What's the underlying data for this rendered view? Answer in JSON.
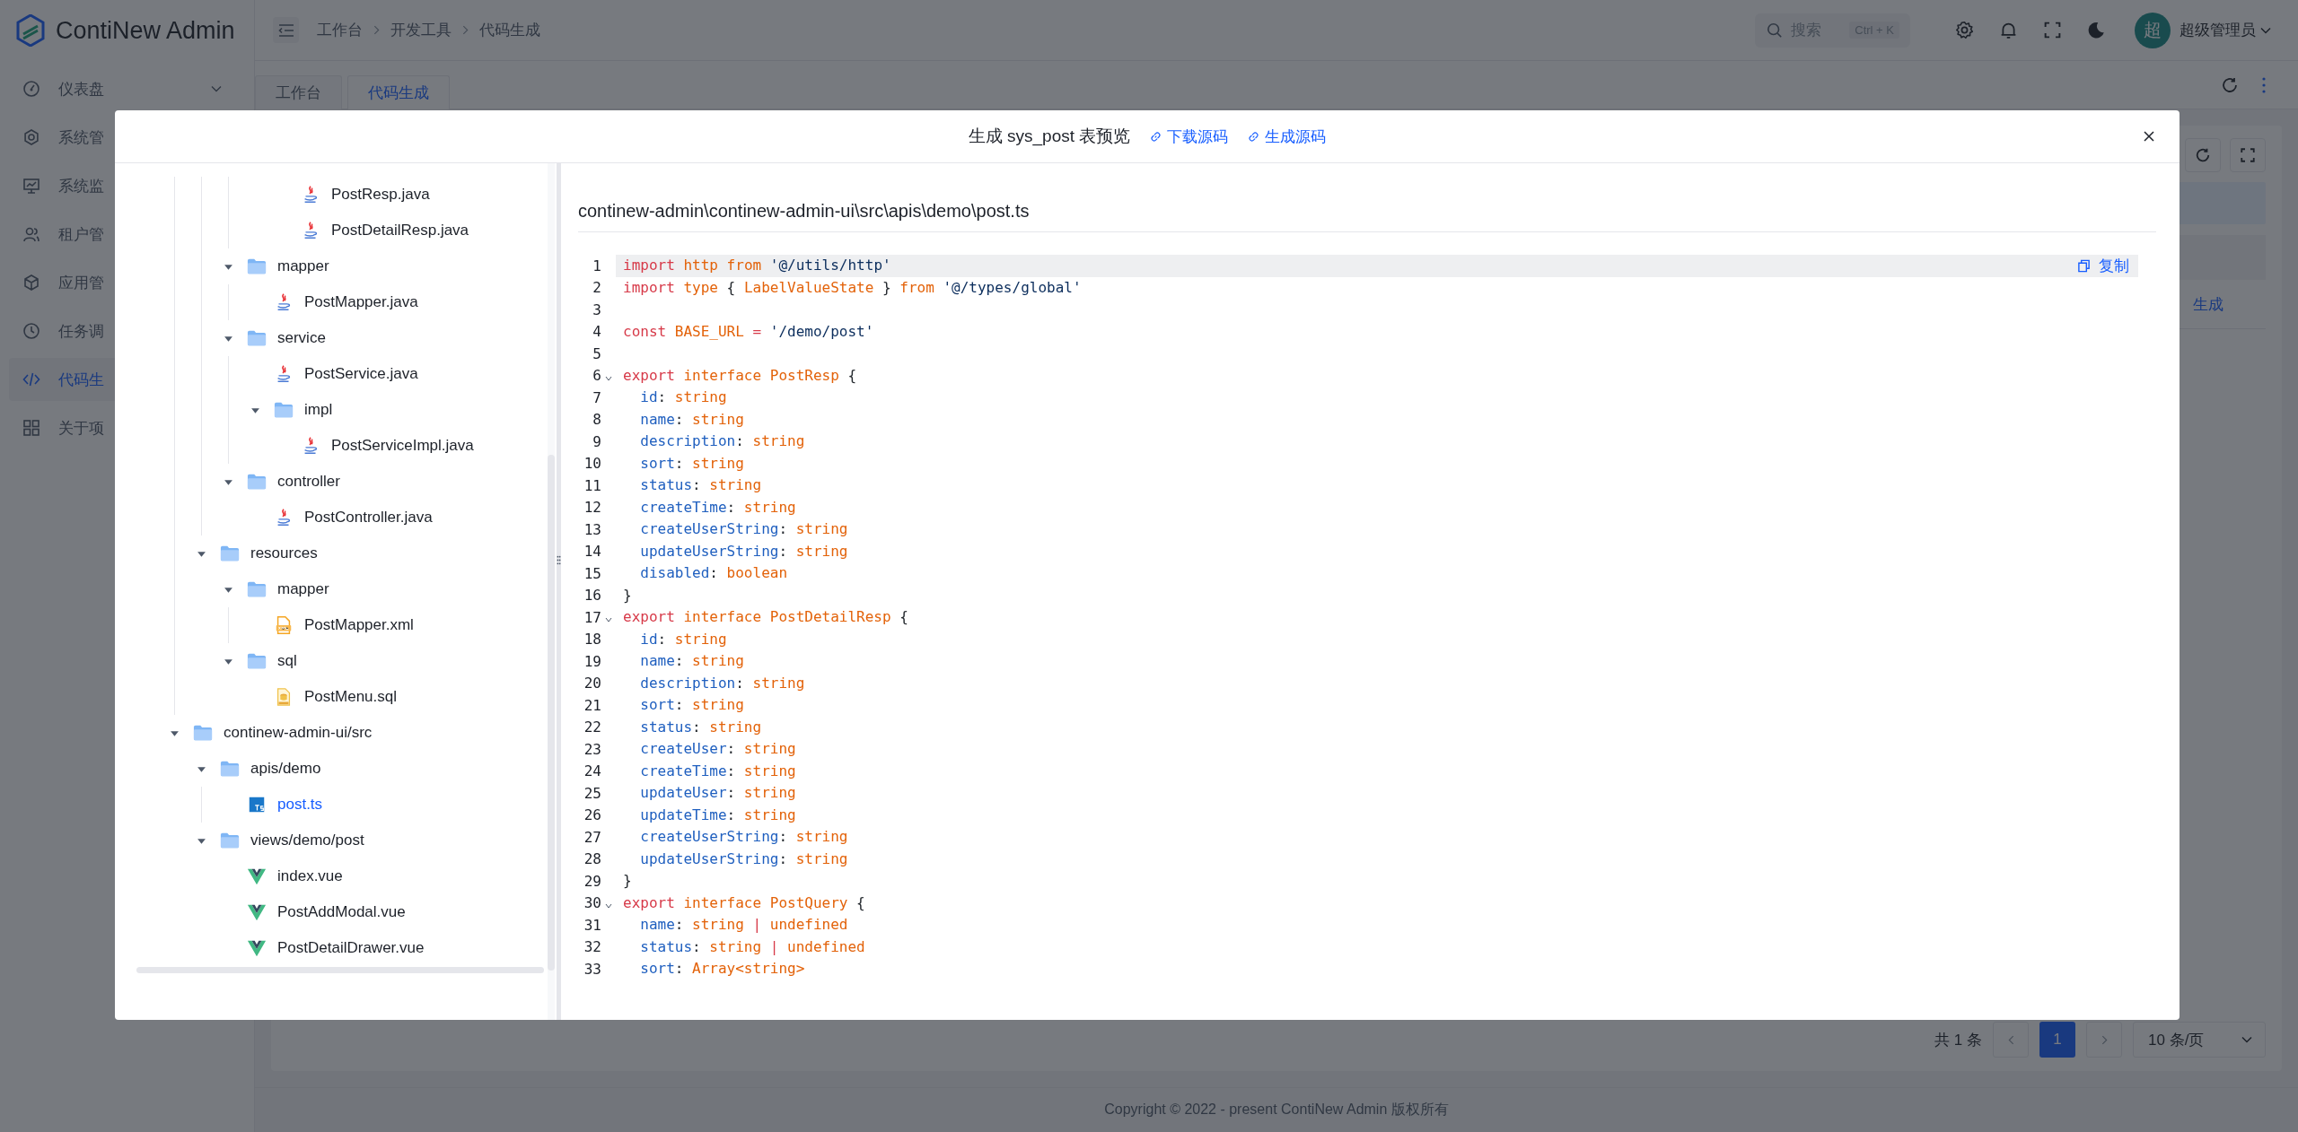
{
  "app": {
    "logo_text": "ContiNew Admin"
  },
  "header": {
    "breadcrumbs": [
      "工作台",
      "开发工具",
      "代码生成"
    ],
    "search": {
      "placeholder": "搜索",
      "shortcut": "Ctrl + K"
    },
    "avatar_text": "超",
    "user_name": "超级管理员"
  },
  "sidebar": {
    "items": [
      {
        "label": "仪表盘",
        "selected": false,
        "expandable": true
      },
      {
        "label": "系统管",
        "selected": false
      },
      {
        "label": "系统监",
        "selected": false
      },
      {
        "label": "租户管",
        "selected": false
      },
      {
        "label": "应用管",
        "selected": false
      },
      {
        "label": "任务调",
        "selected": false
      },
      {
        "label": "代码生",
        "selected": true
      },
      {
        "label": "关于项",
        "selected": false
      }
    ]
  },
  "tabs": [
    {
      "label": "工作台",
      "selected": false
    },
    {
      "label": "代码生成",
      "selected": true
    }
  ],
  "table": {
    "rows": [
      {
        "action_link": "生成"
      }
    ]
  },
  "pagination": {
    "total": "共 1 条",
    "pages": [
      {
        "label": "1",
        "selected": true
      }
    ],
    "page_size": "10 条/页"
  },
  "footer": {
    "copyright": "Copyright © 2022 - present ContiNew Admin 版权所有"
  },
  "modal": {
    "title": "生成 sys_post 表预览",
    "links": [
      "下载源码",
      "生成源码"
    ],
    "tree": [
      {
        "children": [
          {
            "children": [
              {
                "children": [
                  {
                    "children": [
                      {
                        "label": "PostResp.java",
                        "kind": "java",
                        "selected": false
                      },
                      {
                        "label": "PostDetailResp.java",
                        "kind": "java",
                        "selected": false
                      }
                    ]
                  }
                ]
              },
              {
                "label": "mapper",
                "kind": "folder",
                "expanded": true,
                "children": [
                  {
                    "label": "PostMapper.java",
                    "kind": "java",
                    "selected": false
                  }
                ]
              },
              {
                "label": "service",
                "kind": "folder",
                "expanded": true,
                "children": [
                  {
                    "label": "PostService.java",
                    "kind": "java",
                    "selected": false
                  },
                  {
                    "label": "impl",
                    "kind": "folder",
                    "expanded": true,
                    "children": [
                      {
                        "label": "PostServiceImpl.java",
                        "kind": "java",
                        "selected": false
                      }
                    ]
                  }
                ]
              },
              {
                "label": "controller",
                "kind": "folder",
                "expanded": true,
                "children": [
                  {
                    "label": "PostController.java",
                    "kind": "java",
                    "selected": false
                  }
                ]
              }
            ]
          },
          {
            "label": "resources",
            "kind": "folder",
            "expanded": true,
            "children": [
              {
                "label": "mapper",
                "kind": "folder",
                "expanded": true,
                "children": [
                  {
                    "label": "PostMapper.xml",
                    "kind": "xml",
                    "selected": false
                  }
                ]
              },
              {
                "label": "sql",
                "kind": "folder",
                "expanded": true,
                "children": [
                  {
                    "label": "PostMenu.sql",
                    "kind": "sql",
                    "selected": false
                  }
                ]
              }
            ]
          }
        ]
      },
      {
        "label": "continew-admin-ui/src",
        "kind": "folder",
        "expanded": true,
        "children": [
          {
            "label": "apis/demo",
            "kind": "folder",
            "expanded": true,
            "children": [
              {
                "label": "post.ts",
                "kind": "ts",
                "selected": true
              }
            ]
          },
          {
            "label": "views/demo/post",
            "kind": "folder",
            "expanded": true,
            "children": [
              {
                "label": "index.vue",
                "kind": "vue",
                "selected": false
              },
              {
                "label": "PostAddModal.vue",
                "kind": "vue",
                "selected": false
              },
              {
                "label": "PostDetailDrawer.vue",
                "kind": "vue",
                "selected": false
              }
            ]
          }
        ]
      }
    ],
    "code": {
      "path": "continew-admin\\continew-admin-ui\\src\\apis\\demo\\post.ts",
      "copy_label": "复制",
      "lines": [
        {
          "number": "1",
          "active": true,
          "foldable": false,
          "tokens": [
            {
              "kind": "keyword",
              "text": "import "
            },
            {
              "kind": "type",
              "text": "http "
            },
            {
              "kind": "type",
              "text": "from "
            },
            {
              "kind": "string",
              "text": "'@/utils/http'"
            }
          ]
        },
        {
          "number": "2",
          "active": false,
          "foldable": false,
          "tokens": [
            {
              "kind": "keyword",
              "text": "import "
            },
            {
              "kind": "type",
              "text": "type "
            },
            {
              "kind": "punct",
              "text": "{ "
            },
            {
              "kind": "type",
              "text": "LabelValueState "
            },
            {
              "kind": "punct",
              "text": "} "
            },
            {
              "kind": "type",
              "text": "from "
            },
            {
              "kind": "string",
              "text": "'@/types/global'"
            }
          ]
        },
        {
          "number": "3",
          "active": false,
          "foldable": false
        },
        {
          "number": "4",
          "active": false,
          "foldable": false,
          "tokens": [
            {
              "kind": "keyword",
              "text": "const "
            },
            {
              "kind": "type",
              "text": "BASE_URL "
            },
            {
              "kind": "operator",
              "text": "= "
            },
            {
              "kind": "string",
              "text": "'/demo/post'"
            }
          ]
        },
        {
          "number": "5",
          "active": false,
          "foldable": false
        },
        {
          "number": "6",
          "active": false,
          "foldable": true,
          "tokens": [
            {
              "kind": "keyword",
              "text": "export "
            },
            {
              "kind": "type",
              "text": "interface "
            },
            {
              "kind": "type",
              "text": "PostResp "
            },
            {
              "kind": "punct",
              "text": "{"
            }
          ]
        },
        {
          "number": "7",
          "active": false,
          "foldable": false,
          "tokens": [
            {
              "kind": "property",
              "text": "  id"
            },
            {
              "kind": "punct",
              "text": ": "
            },
            {
              "kind": "type",
              "text": "string"
            }
          ]
        },
        {
          "number": "8",
          "active": false,
          "foldable": false,
          "tokens": [
            {
              "kind": "property",
              "text": "  name"
            },
            {
              "kind": "punct",
              "text": ": "
            },
            {
              "kind": "type",
              "text": "string"
            }
          ]
        },
        {
          "number": "9",
          "active": false,
          "foldable": false,
          "tokens": [
            {
              "kind": "property",
              "text": "  description"
            },
            {
              "kind": "punct",
              "text": ": "
            },
            {
              "kind": "type",
              "text": "string"
            }
          ]
        },
        {
          "number": "10",
          "active": false,
          "foldable": false,
          "tokens": [
            {
              "kind": "property",
              "text": "  sort"
            },
            {
              "kind": "punct",
              "text": ": "
            },
            {
              "kind": "type",
              "text": "string"
            }
          ]
        },
        {
          "number": "11",
          "active": false,
          "foldable": false,
          "tokens": [
            {
              "kind": "property",
              "text": "  status"
            },
            {
              "kind": "punct",
              "text": ": "
            },
            {
              "kind": "type",
              "text": "string"
            }
          ]
        },
        {
          "number": "12",
          "active": false,
          "foldable": false,
          "tokens": [
            {
              "kind": "property",
              "text": "  createTime"
            },
            {
              "kind": "punct",
              "text": ": "
            },
            {
              "kind": "type",
              "text": "string"
            }
          ]
        },
        {
          "number": "13",
          "active": false,
          "foldable": false,
          "tokens": [
            {
              "kind": "property",
              "text": "  createUserString"
            },
            {
              "kind": "punct",
              "text": ": "
            },
            {
              "kind": "type",
              "text": "string"
            }
          ]
        },
        {
          "number": "14",
          "active": false,
          "foldable": false,
          "tokens": [
            {
              "kind": "property",
              "text": "  updateUserString"
            },
            {
              "kind": "punct",
              "text": ": "
            },
            {
              "kind": "type",
              "text": "string"
            }
          ]
        },
        {
          "number": "15",
          "active": false,
          "foldable": false,
          "tokens": [
            {
              "kind": "property",
              "text": "  disabled"
            },
            {
              "kind": "punct",
              "text": ": "
            },
            {
              "kind": "type",
              "text": "boolean"
            }
          ]
        },
        {
          "number": "16",
          "active": false,
          "foldable": false,
          "tokens": [
            {
              "kind": "punct",
              "text": "}"
            }
          ]
        },
        {
          "number": "17",
          "active": false,
          "foldable": true,
          "tokens": [
            {
              "kind": "keyword",
              "text": "export "
            },
            {
              "kind": "type",
              "text": "interface "
            },
            {
              "kind": "type",
              "text": "PostDetailResp "
            },
            {
              "kind": "punct",
              "text": "{"
            }
          ]
        },
        {
          "number": "18",
          "active": false,
          "foldable": false,
          "tokens": [
            {
              "kind": "property",
              "text": "  id"
            },
            {
              "kind": "punct",
              "text": ": "
            },
            {
              "kind": "type",
              "text": "string"
            }
          ]
        },
        {
          "number": "19",
          "active": false,
          "foldable": false,
          "tokens": [
            {
              "kind": "property",
              "text": "  name"
            },
            {
              "kind": "punct",
              "text": ": "
            },
            {
              "kind": "type",
              "text": "string"
            }
          ]
        },
        {
          "number": "20",
          "active": false,
          "foldable": false,
          "tokens": [
            {
              "kind": "property",
              "text": "  description"
            },
            {
              "kind": "punct",
              "text": ": "
            },
            {
              "kind": "type",
              "text": "string"
            }
          ]
        },
        {
          "number": "21",
          "active": false,
          "foldable": false,
          "tokens": [
            {
              "kind": "property",
              "text": "  sort"
            },
            {
              "kind": "punct",
              "text": ": "
            },
            {
              "kind": "type",
              "text": "string"
            }
          ]
        },
        {
          "number": "22",
          "active": false,
          "foldable": false,
          "tokens": [
            {
              "kind": "property",
              "text": "  status"
            },
            {
              "kind": "punct",
              "text": ": "
            },
            {
              "kind": "type",
              "text": "string"
            }
          ]
        },
        {
          "number": "23",
          "active": false,
          "foldable": false,
          "tokens": [
            {
              "kind": "property",
              "text": "  createUser"
            },
            {
              "kind": "punct",
              "text": ": "
            },
            {
              "kind": "type",
              "text": "string"
            }
          ]
        },
        {
          "number": "24",
          "active": false,
          "foldable": false,
          "tokens": [
            {
              "kind": "property",
              "text": "  createTime"
            },
            {
              "kind": "punct",
              "text": ": "
            },
            {
              "kind": "type",
              "text": "string"
            }
          ]
        },
        {
          "number": "25",
          "active": false,
          "foldable": false,
          "tokens": [
            {
              "kind": "property",
              "text": "  updateUser"
            },
            {
              "kind": "punct",
              "text": ": "
            },
            {
              "kind": "type",
              "text": "string"
            }
          ]
        },
        {
          "number": "26",
          "active": false,
          "foldable": false,
          "tokens": [
            {
              "kind": "property",
              "text": "  updateTime"
            },
            {
              "kind": "punct",
              "text": ": "
            },
            {
              "kind": "type",
              "text": "string"
            }
          ]
        },
        {
          "number": "27",
          "active": false,
          "foldable": false,
          "tokens": [
            {
              "kind": "property",
              "text": "  createUserString"
            },
            {
              "kind": "punct",
              "text": ": "
            },
            {
              "kind": "type",
              "text": "string"
            }
          ]
        },
        {
          "number": "28",
          "active": false,
          "foldable": false,
          "tokens": [
            {
              "kind": "property",
              "text": "  updateUserString"
            },
            {
              "kind": "punct",
              "text": ": "
            },
            {
              "kind": "type",
              "text": "string"
            }
          ]
        },
        {
          "number": "29",
          "active": false,
          "foldable": false,
          "tokens": [
            {
              "kind": "punct",
              "text": "}"
            }
          ]
        },
        {
          "number": "30",
          "active": false,
          "foldable": true,
          "tokens": [
            {
              "kind": "keyword",
              "text": "export "
            },
            {
              "kind": "type",
              "text": "interface "
            },
            {
              "kind": "type",
              "text": "PostQuery "
            },
            {
              "kind": "punct",
              "text": "{"
            }
          ]
        },
        {
          "number": "31",
          "active": false,
          "foldable": false,
          "tokens": [
            {
              "kind": "property",
              "text": "  name"
            },
            {
              "kind": "punct",
              "text": ": "
            },
            {
              "kind": "type",
              "text": "string "
            },
            {
              "kind": "operator",
              "text": "| "
            },
            {
              "kind": "type",
              "text": "undefined"
            }
          ]
        },
        {
          "number": "32",
          "active": false,
          "foldable": false,
          "tokens": [
            {
              "kind": "property",
              "text": "  status"
            },
            {
              "kind": "punct",
              "text": ": "
            },
            {
              "kind": "type",
              "text": "string "
            },
            {
              "kind": "operator",
              "text": "| "
            },
            {
              "kind": "type",
              "text": "undefined"
            }
          ]
        },
        {
          "number": "33",
          "active": false,
          "foldable": false,
          "tokens": [
            {
              "kind": "property",
              "text": "  sort"
            },
            {
              "kind": "punct",
              "text": ": "
            },
            {
              "kind": "type",
              "text": "Array<string>"
            }
          ]
        }
      ]
    }
  }
}
